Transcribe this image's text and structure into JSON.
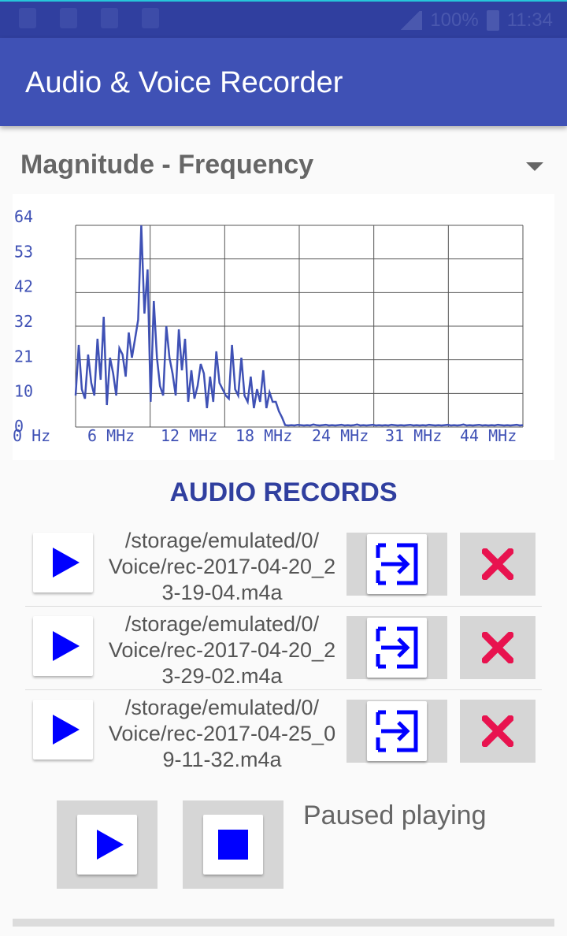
{
  "status_bar": {
    "battery": "100%",
    "time": "11:34"
  },
  "app": {
    "title": "Audio & Voice Recorder"
  },
  "spinner": {
    "selected": "Magnitude - Frequency"
  },
  "chart_data": {
    "type": "line",
    "y_ticks": [
      "64",
      "53",
      "42",
      "32",
      "21",
      "10",
      "0"
    ],
    "x_ticks": [
      "0 Hz",
      "6 MHz",
      "12 MHz",
      "18 MHz",
      "24 MHz",
      "31 MHz",
      "44 MHz"
    ],
    "ylim": [
      0,
      64
    ],
    "grid": true,
    "color": "#3f51b5",
    "values": [
      10,
      26,
      12,
      9,
      23,
      14,
      10,
      28,
      15,
      35,
      7,
      22,
      17,
      10,
      25,
      23,
      16,
      30,
      22,
      28,
      34,
      64,
      36,
      50,
      8,
      40,
      22,
      13,
      10,
      32,
      22,
      17,
      10,
      31,
      18,
      28,
      8,
      18,
      9,
      13,
      20,
      17,
      6,
      16,
      8,
      24,
      14,
      12,
      10,
      9,
      26,
      12,
      10,
      22,
      10,
      8,
      16,
      6,
      12,
      8,
      18,
      6,
      11,
      8,
      8,
      5,
      3,
      0.6,
      0.5,
      0.6,
      0.5,
      0.7,
      0.6,
      0.5,
      0.6,
      0.5,
      0.8,
      0.6,
      0.5,
      0.6,
      0.7,
      0.5,
      0.6,
      0.5,
      0.6,
      0.7,
      0.5,
      0.6,
      0.5,
      0.6,
      0.8,
      0.5,
      0.6,
      0.5,
      0.6,
      0.7,
      0.5,
      0.6,
      0.5,
      0.6,
      0.5,
      0.7,
      0.6,
      0.5,
      0.6,
      0.5,
      0.6,
      0.7,
      0.5,
      0.6,
      0.5,
      0.6,
      0.5,
      0.7,
      0.6,
      0.5,
      0.6,
      0.5,
      0.6,
      0.7,
      0.5,
      0.6,
      0.5,
      0.6,
      0.8,
      0.5,
      0.6,
      0.5,
      0.6,
      0.7,
      0.5,
      0.6,
      0.5,
      0.6,
      0.5,
      0.7,
      0.6,
      0.5,
      0.6,
      0.5,
      0.6,
      0.7,
      0.5,
      0.6
    ]
  },
  "records": {
    "title": "AUDIO RECORDS",
    "items": [
      {
        "line1": "/storage/emulated/0/",
        "line2": "Voice/rec-2017-04-20_2",
        "line3": "3-19-04.m4a"
      },
      {
        "line1": "/storage/emulated/0/",
        "line2": "Voice/rec-2017-04-20_2",
        "line3": "3-29-02.m4a"
      },
      {
        "line1": "/storage/emulated/0/",
        "line2": "Voice/rec-2017-04-25_0",
        "line3": "9-11-32.m4a"
      }
    ]
  },
  "player": {
    "status": "Paused playing"
  },
  "colors": {
    "primary": "#3f51b5",
    "primary_dark": "#303f9f",
    "accent_blue": "#0000ff",
    "delete_red": "#e8134f"
  }
}
